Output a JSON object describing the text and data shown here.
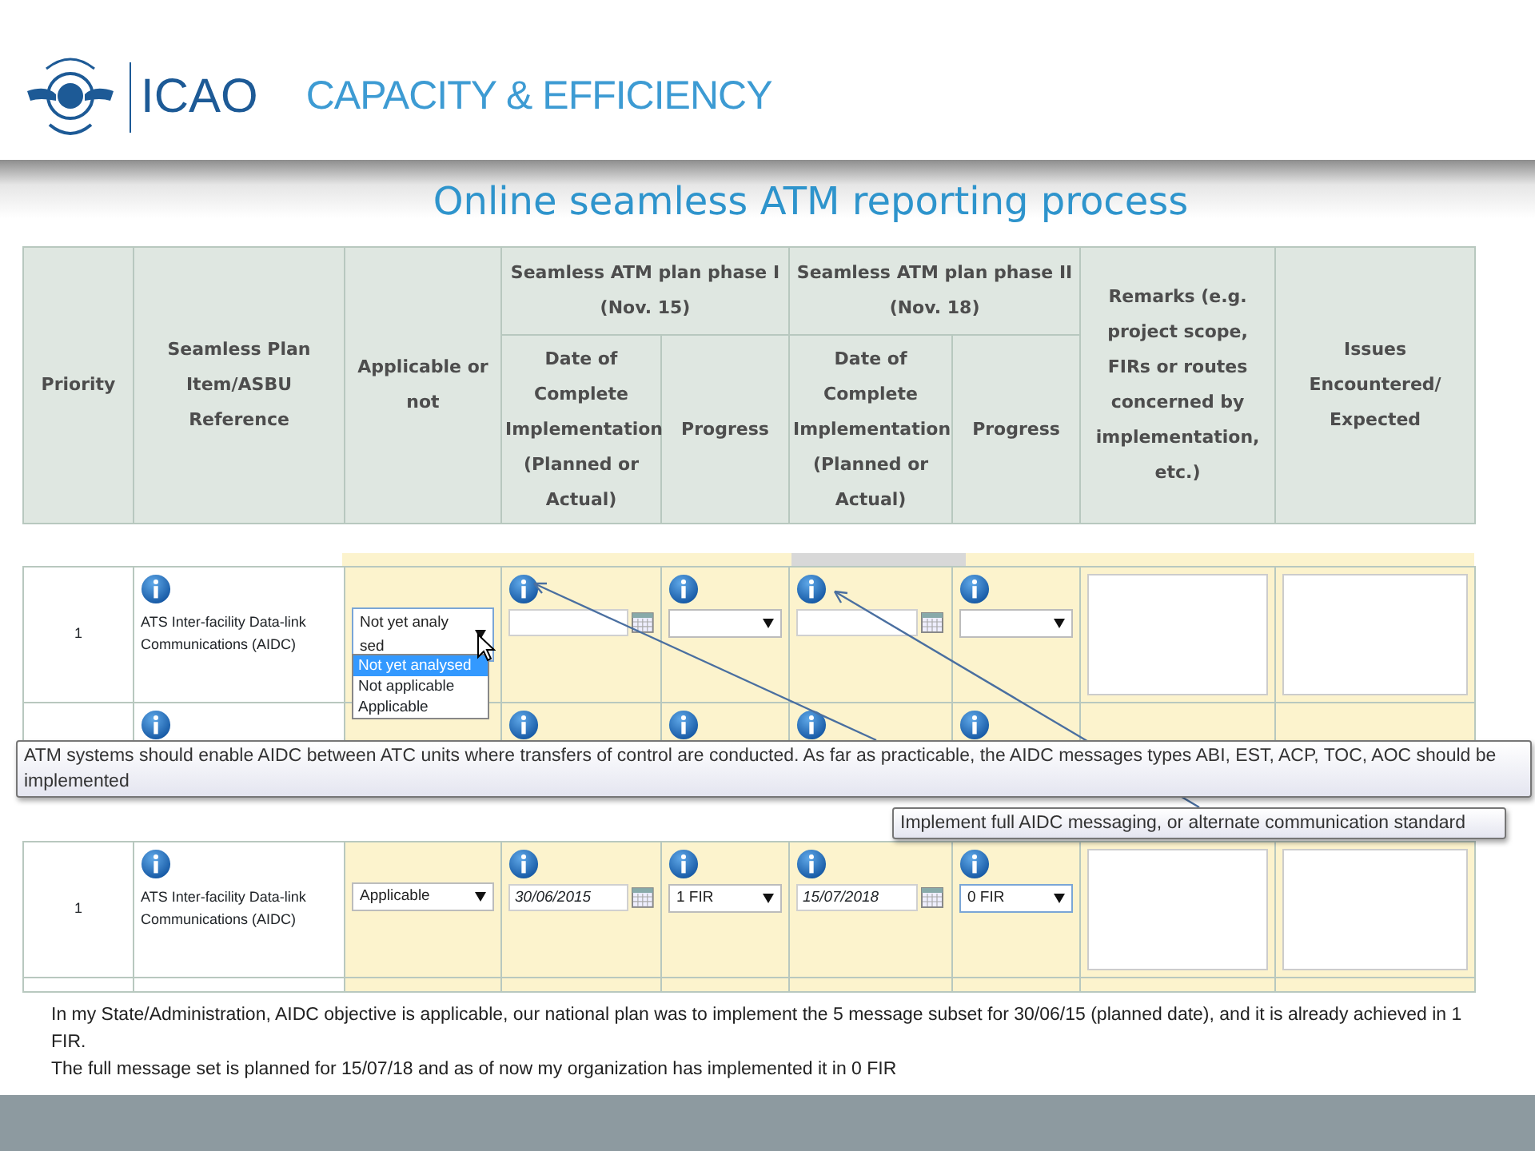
{
  "header": {
    "organization": "ICAO",
    "theme": "CAPACITY & EFFICIENCY"
  },
  "title": "Online seamless ATM reporting process",
  "table_header": {
    "columns": [
      {
        "label": "Priority"
      },
      {
        "label": "Seamless Plan Item/ASBU Reference"
      },
      {
        "label": "Applicable or not"
      },
      {
        "label": "Seamless ATM plan phase I (Nov. 15)",
        "children": [
          {
            "label": "Date of Complete Implementation (Planned or Actual)"
          },
          {
            "label": "Progress"
          }
        ]
      },
      {
        "label": "Seamless ATM plan phase II (Nov. 18)",
        "children": [
          {
            "label": "Date of Complete Implementation (Planned or Actual)"
          },
          {
            "label": "Progress"
          }
        ]
      },
      {
        "label": "Remarks (e.g. project scope, FIRs or routes concerned by implementation, etc.)"
      },
      {
        "label": "Issues Encountered/ Expected"
      }
    ]
  },
  "form_before": {
    "priority": "1",
    "item": "ATS Inter-facility Data-link Communications (AIDC)",
    "applicable": {
      "value": "Not yet analysed",
      "expanded": true,
      "options": [
        {
          "label": "Not yet analysed",
          "selected": true
        },
        {
          "label": "Not applicable",
          "selected": false
        },
        {
          "label": "Applicable",
          "selected": false
        }
      ]
    }
  },
  "tooltips": [
    {
      "text": "ATM systems should enable AIDC between ATC units where transfers of control are conducted. As far as practicable, the AIDC messages types ABI, EST, ACP, TOC, AOC should be implemented"
    },
    {
      "text": "Implement full AIDC messaging, or alternate communication standard"
    }
  ],
  "form_after": {
    "priority": "1",
    "item": "ATS Inter-facility Data-link Communications (AIDC)",
    "applicable": {
      "value": "Applicable",
      "expanded": false
    },
    "phase1_date": "30/06/2015",
    "phase1_progress": "1 FIR",
    "phase2_date": "15/07/2018",
    "phase2_progress": "0 FIR"
  },
  "note": {
    "lines": [
      "In my State/Administration, AIDC objective is applicable, our national plan was to implement the 5 message subset for 30/06/15 (planned date), and it is already achieved in 1 FIR.",
      "The full message set is planned for 15/07/18 and as of now my organization has implemented it in 0 FIR"
    ]
  }
}
